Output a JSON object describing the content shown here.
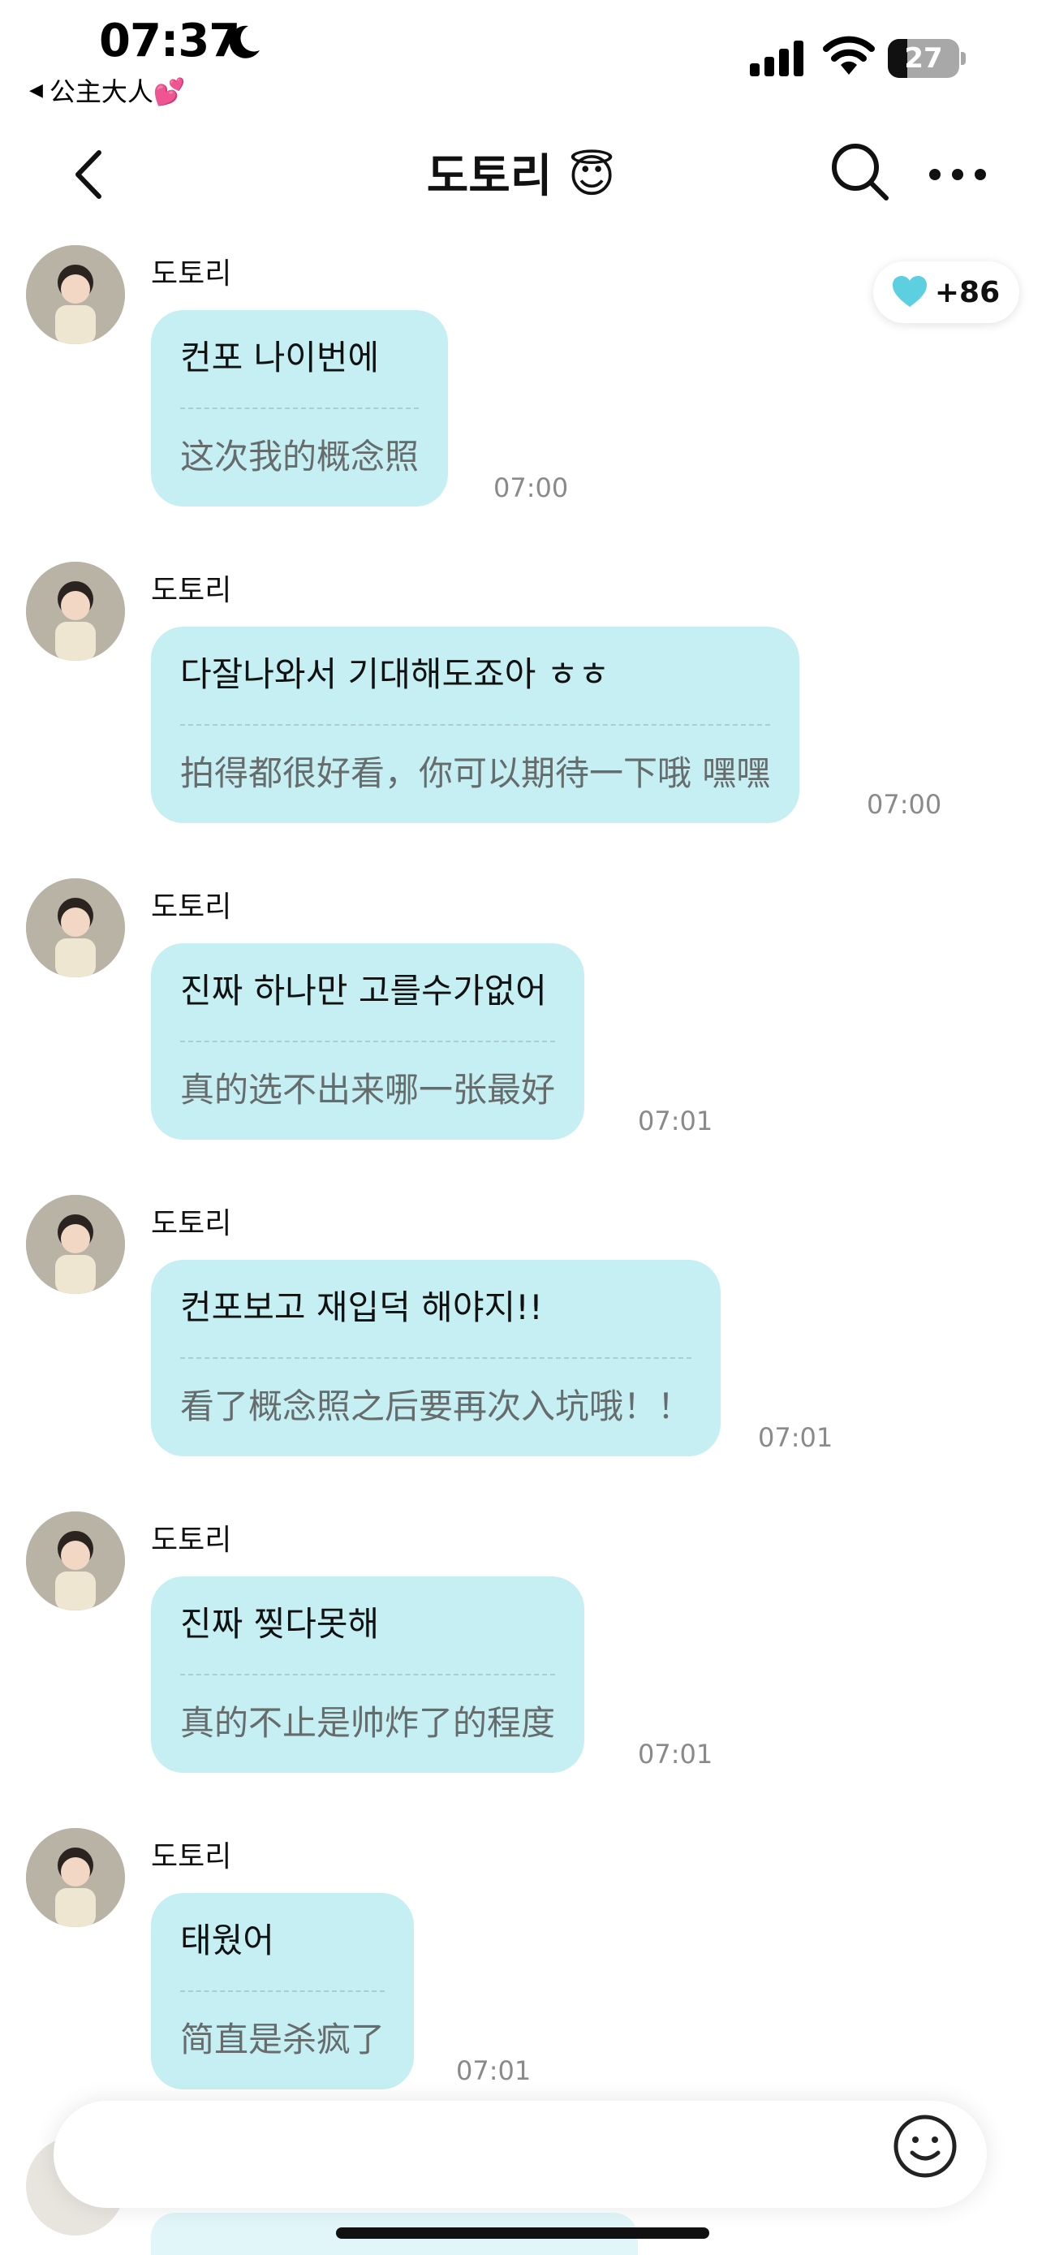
{
  "status_bar": {
    "time": "07:37",
    "back_app_label": "公主大人💕",
    "battery": "27"
  },
  "header": {
    "title": "도토리 😇"
  },
  "heart_badge": {
    "count": "+86",
    "color": "#5ccfe0"
  },
  "messages": [
    {
      "sender": "도토리",
      "ko": "컨포 나이번에",
      "zh": "这次我的概念照",
      "time": "07:00"
    },
    {
      "sender": "도토리",
      "ko": "다잘나와서 기대해도죠아 ㅎㅎ",
      "zh": "拍得都很好看，你可以期待一下哦 嘿嘿",
      "time": "07:00"
    },
    {
      "sender": "도토리",
      "ko": "진짜 하나만 고를수가없어",
      "zh": "真的选不出来哪一张最好",
      "time": "07:01"
    },
    {
      "sender": "도토리",
      "ko": "컨포보고 재입덕 해야지!!",
      "zh": "看了概念照之后要再次入坑哦！！",
      "time": "07:01"
    },
    {
      "sender": "도토리",
      "ko": "진짜 찢다못해",
      "zh": "真的不止是帅炸了的程度",
      "time": "07:01"
    },
    {
      "sender": "도토리",
      "ko": "태웠어",
      "zh": "简直是杀疯了",
      "time": "07:01"
    }
  ],
  "colors": {
    "bubble": "#c6eff3",
    "divider": "#a8cdd2",
    "timestamp": "#8a8a8a"
  },
  "icons": {
    "back": "chevron-left-icon",
    "search": "search-icon",
    "more": "more-horizontal-icon",
    "emoji": "smiley-icon",
    "heart": "heart-icon"
  }
}
